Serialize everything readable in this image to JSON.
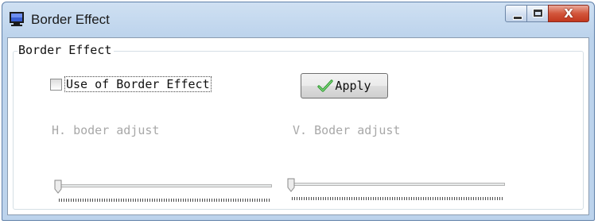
{
  "window": {
    "title": "Border Effect",
    "icon": "monitor-app-icon",
    "caption_buttons": [
      "minimize",
      "maximize",
      "close"
    ],
    "close_glyph": "X",
    "frame_color": "#bcd3ec",
    "close_color": "#c2371e"
  },
  "group": {
    "legend": "Border Effect",
    "checkbox": {
      "label": "Use of Border Effect",
      "checked": false
    },
    "apply_button": {
      "label": "Apply",
      "icon": "green-check-icon"
    },
    "h_slider": {
      "label": "H. boder adjust",
      "value": 0,
      "enabled": false
    },
    "v_slider": {
      "label": "V. Boder adjust",
      "value": 0,
      "enabled": false
    },
    "disabled_text_color": "#a8a8a8"
  }
}
